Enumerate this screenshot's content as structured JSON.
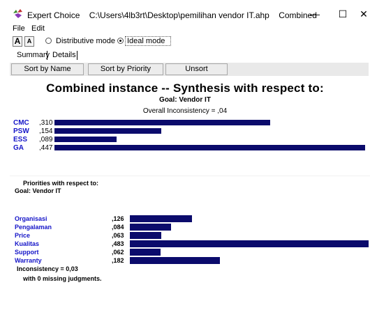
{
  "window": {
    "app_name": "Expert Choice",
    "file_path": "C:\\Users\\4lb3rt\\Desktop\\pemilihan vendor IT.ahp",
    "view_name": "Combined",
    "minimize_glyph": "—",
    "maximize_glyph": "☐",
    "close_glyph": "✕"
  },
  "menu": {
    "file": "File",
    "edit": "Edit"
  },
  "toolbar": {
    "font_larger": "A",
    "font_smaller": "A",
    "distributive_mode": "Distributive mode",
    "ideal_mode": "Ideal mode",
    "selected_mode": "ideal"
  },
  "tabs": {
    "summary": "Summary",
    "details": "Details"
  },
  "sort_buttons": {
    "by_name": "Sort by Name",
    "by_priority": "Sort by Priority",
    "unsort": "Unsort"
  },
  "synthesis": {
    "title": "Combined instance -- Synthesis with respect to:",
    "goal": "Goal: Vendor IT",
    "overall_inconsistency": "Overall Inconsistency = ,04",
    "bar_color": "#0b0b6c",
    "name_color": "#1515c8",
    "alternatives": [
      {
        "name": "CMC",
        "value": ",310",
        "priority": 0.31
      },
      {
        "name": "PSW",
        "value": ",154",
        "priority": 0.154
      },
      {
        "name": "ESS",
        "value": ",089",
        "priority": 0.089
      },
      {
        "name": "GA",
        "value": ",447",
        "priority": 0.447
      }
    ]
  },
  "priorities": {
    "title": "Priorities with respect to:",
    "goal": "Goal: Vendor IT",
    "criteria": [
      {
        "name": "Organisasi",
        "value": ",126",
        "priority": 0.126
      },
      {
        "name": "Pengalaman",
        "value": ",084",
        "priority": 0.084
      },
      {
        "name": "Price",
        "value": ",063",
        "priority": 0.063
      },
      {
        "name": "Kualitas",
        "value": ",483",
        "priority": 0.483
      },
      {
        "name": "Support",
        "value": ",062",
        "priority": 0.062
      },
      {
        "name": "Warranty",
        "value": ",182",
        "priority": 0.182
      }
    ],
    "inconsistency": "Inconsistency = 0,03",
    "missing": "with 0  missing judgments."
  }
}
